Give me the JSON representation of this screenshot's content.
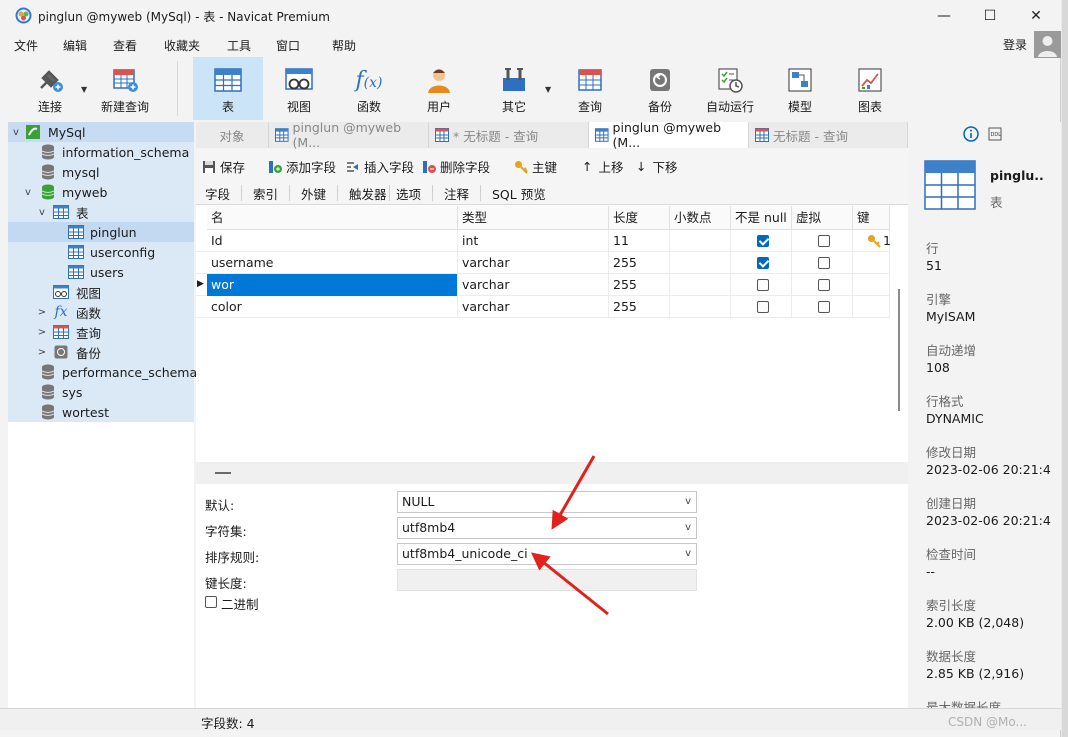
{
  "window": {
    "title": "pinglun @myweb (MySql) - 表 - Navicat Premium",
    "controls": {
      "minimize": "—",
      "maximize": "☐",
      "close": "✕"
    }
  },
  "menu": {
    "items": [
      "文件",
      "编辑",
      "查看",
      "收藏夹",
      "工具",
      "窗口",
      "帮助"
    ],
    "login": "登录"
  },
  "toolbar": {
    "connect": "连接",
    "new_query": "新建查询",
    "table": "表",
    "view": "视图",
    "function": "函数",
    "user": "用户",
    "other": "其它",
    "query": "查询",
    "backup": "备份",
    "automation": "自动运行",
    "model": "模型",
    "chart": "图表"
  },
  "sidebar": {
    "items": [
      {
        "label": "MySql"
      },
      {
        "label": "information_schema"
      },
      {
        "label": "mysql"
      },
      {
        "label": "myweb"
      },
      {
        "label": "表"
      },
      {
        "label": "pinglun"
      },
      {
        "label": "userconfig"
      },
      {
        "label": "users"
      },
      {
        "label": "视图"
      },
      {
        "label": "函数"
      },
      {
        "label": "查询"
      },
      {
        "label": "备份"
      },
      {
        "label": "performance_schema"
      },
      {
        "label": "sys"
      },
      {
        "label": "wortest"
      }
    ]
  },
  "tabs": [
    {
      "label": "对象"
    },
    {
      "label": "pinglun @myweb (M..."
    },
    {
      "label": "* 无标题 - 查询"
    },
    {
      "label": "pinglun @myweb (M..."
    },
    {
      "label": "无标题 - 查询"
    }
  ],
  "subtoolbar": {
    "save": "保存",
    "add_field": "添加字段",
    "insert_field": "插入字段",
    "delete_field": "删除字段",
    "primary_key": "主键",
    "move_up": "上移",
    "move_down": "下移"
  },
  "subtabs": [
    "字段",
    "索引",
    "外键",
    "触发器",
    "选项",
    "注释",
    "SQL 预览"
  ],
  "grid": {
    "headers": [
      "名",
      "类型",
      "长度",
      "小数点",
      "不是 null",
      "虚拟",
      "键"
    ],
    "rows": [
      {
        "name": "Id",
        "type": "int",
        "length": "11",
        "decimals": "",
        "not_null": true,
        "virtual": false,
        "key": "1"
      },
      {
        "name": "username",
        "type": "varchar",
        "length": "255",
        "decimals": "",
        "not_null": true,
        "virtual": false,
        "key": ""
      },
      {
        "name": "wor",
        "type": "varchar",
        "length": "255",
        "decimals": "",
        "not_null": false,
        "virtual": false,
        "key": ""
      },
      {
        "name": "color",
        "type": "varchar",
        "length": "255",
        "decimals": "",
        "not_null": false,
        "virtual": false,
        "key": ""
      }
    ]
  },
  "props": {
    "default_label": "默认:",
    "default_value": "NULL",
    "charset_label": "字符集:",
    "charset_value": "utf8mb4",
    "collation_label": "排序规则:",
    "collation_value": "utf8mb4_unicode_ci",
    "key_length_label": "键长度:",
    "binary_label": "二进制"
  },
  "info_panel": {
    "name": "pinglu..",
    "kind": "表",
    "fields": [
      {
        "label": "行",
        "value": "51"
      },
      {
        "label": "引擎",
        "value": "MyISAM"
      },
      {
        "label": "自动递增",
        "value": "108"
      },
      {
        "label": "行格式",
        "value": "DYNAMIC"
      },
      {
        "label": "修改日期",
        "value": "2023-02-06 20:21:4"
      },
      {
        "label": "创建日期",
        "value": "2023-02-06 20:21:4"
      },
      {
        "label": "检查时间",
        "value": "--"
      },
      {
        "label": "索引长度",
        "value": "2.00 KB (2,048)"
      },
      {
        "label": "数据长度",
        "value": "2.85 KB (2,916)"
      },
      {
        "label": "最大数据长度",
        "value": ""
      }
    ]
  },
  "status": {
    "field_count": "字段数: 4"
  },
  "watermark": "CSDN @Mo..."
}
